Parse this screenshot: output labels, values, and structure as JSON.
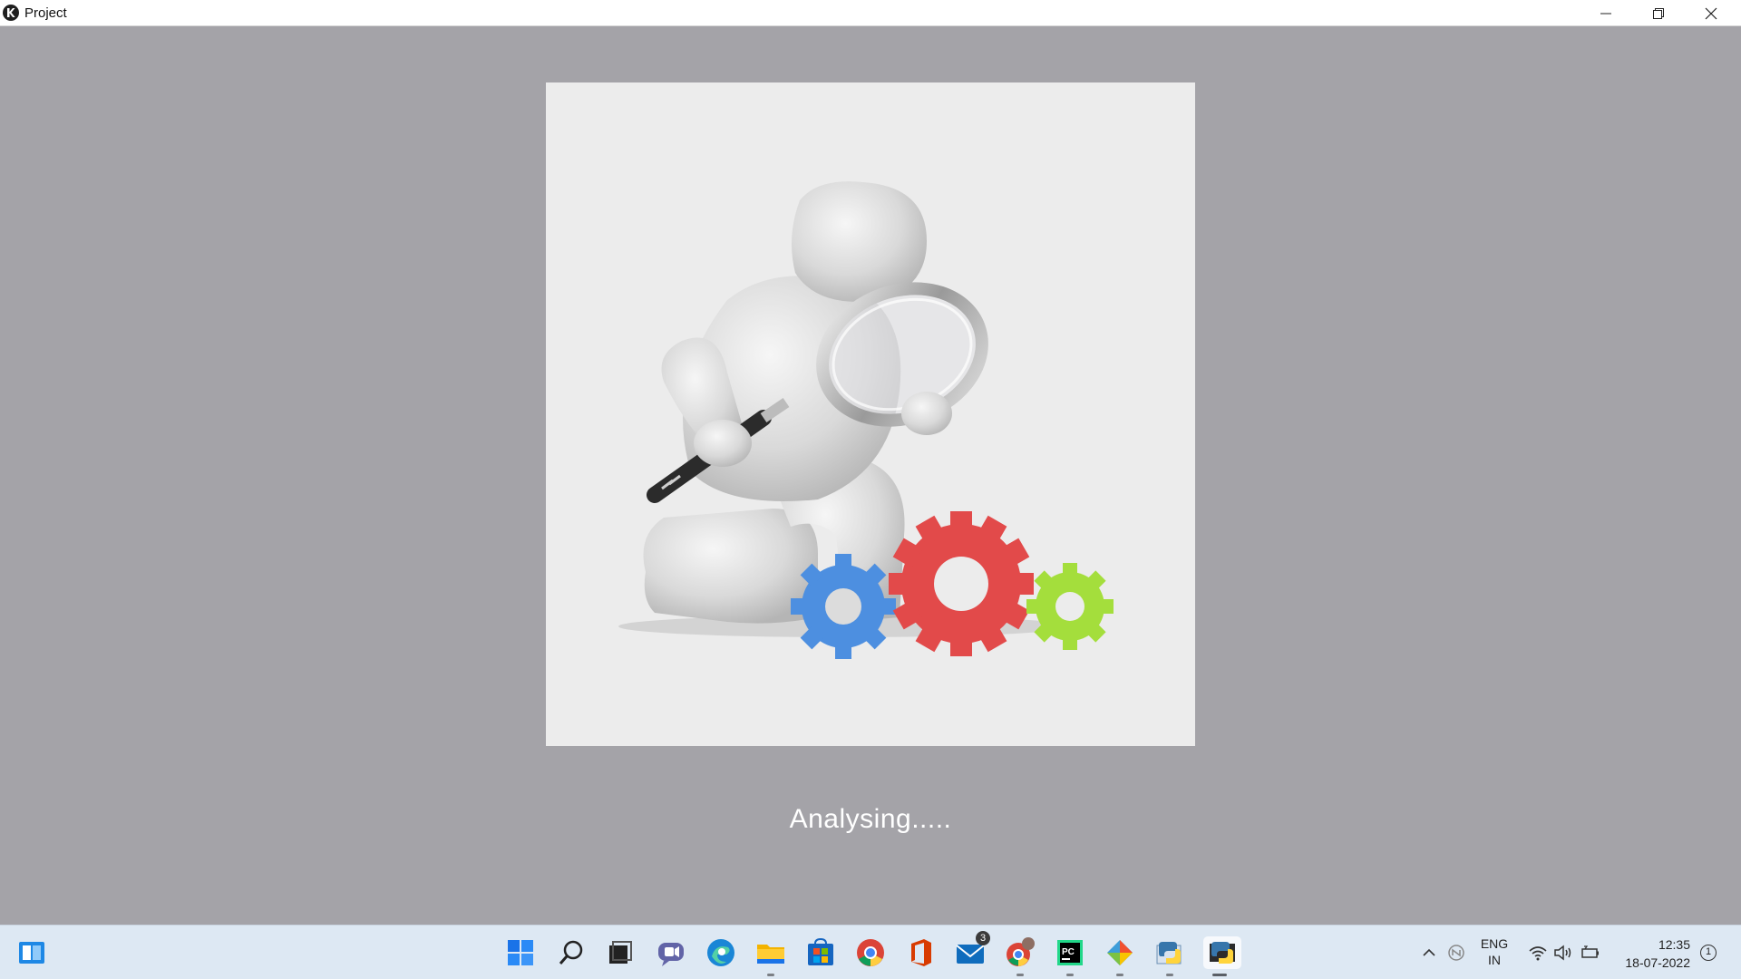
{
  "window": {
    "title": "Project",
    "icon": "kivy-logo-icon",
    "controls": [
      "minimize-icon",
      "restore-icon",
      "close-icon"
    ]
  },
  "main": {
    "image": "person-with-magnifier-and-gears-illustration",
    "status_text": "Analysing....."
  },
  "taskbar": {
    "widgets_icon": "widgets-icon",
    "apps": [
      {
        "name": "start-icon"
      },
      {
        "name": "search-icon"
      },
      {
        "name": "task-view-icon"
      },
      {
        "name": "chat-icon"
      },
      {
        "name": "edge-icon"
      },
      {
        "name": "file-explorer-icon",
        "running": true
      },
      {
        "name": "store-icon"
      },
      {
        "name": "chrome-icon"
      },
      {
        "name": "office-icon"
      },
      {
        "name": "mail-icon",
        "badge": "3"
      },
      {
        "name": "chrome-profile-icon",
        "running": true
      },
      {
        "name": "pycharm-icon",
        "running": true
      },
      {
        "name": "git-icon",
        "running": true
      },
      {
        "name": "python-idle-icon",
        "running": true
      },
      {
        "name": "python-app-icon",
        "running": true,
        "active": true
      }
    ],
    "tray": {
      "language_line1": "ENG",
      "language_line2": "IN",
      "time": "12:35",
      "date": "18-07-2022",
      "notification_count": "1"
    }
  }
}
